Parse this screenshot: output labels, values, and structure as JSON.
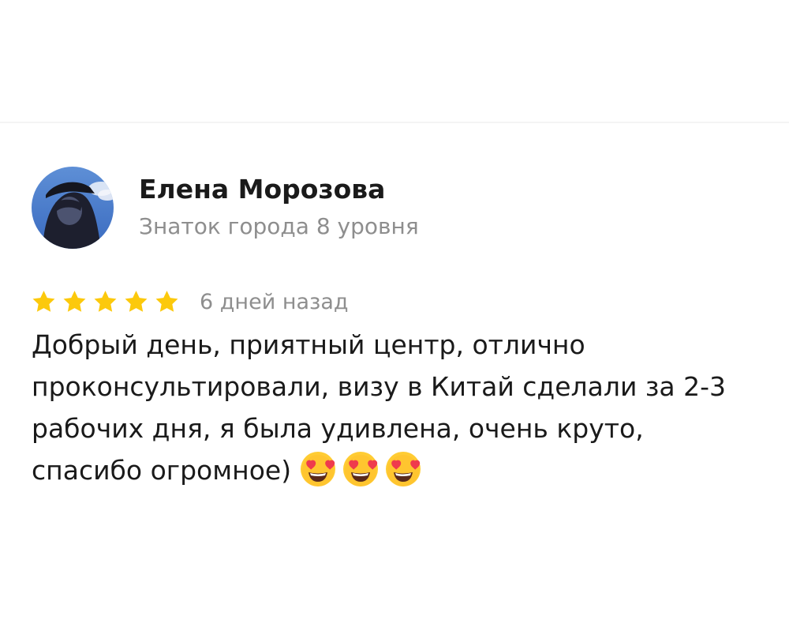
{
  "review": {
    "author_name": "Елена Морозова",
    "author_level": "Знаток города 8 уровня",
    "rating": 5,
    "rating_max": 5,
    "date": "6 дней назад",
    "text": "Добрый день, приятный центр, отлично проконсультировали, визу в Китай сделали за 2-3 рабочих дня, я была удивлена, очень круто, спасибо огромное)",
    "emojis": [
      "heart-eyes-emoji",
      "heart-eyes-emoji",
      "heart-eyes-emoji"
    ]
  },
  "colors": {
    "star": "#fcc90c",
    "secondary_text": "#8e8e8e",
    "primary_text": "#1a1a1a"
  }
}
